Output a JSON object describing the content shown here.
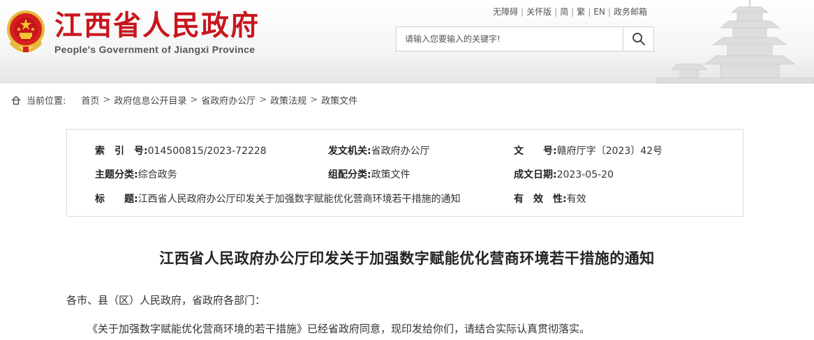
{
  "header": {
    "title_cn": "江西省人民政府",
    "title_en": "People's Government of Jiangxi Province",
    "links": [
      "无障碍",
      "关怀版",
      "简",
      "繁",
      "EN",
      "政务邮箱"
    ],
    "search_placeholder": "请输入您要输入的关键字!",
    "brand_color": "#c8161d"
  },
  "breadcrumb": {
    "label": "当前位置:",
    "items": [
      "首页",
      "政府信息公开目录",
      "省政府办公厅",
      "政策法规",
      "政策文件"
    ],
    "separator": ">"
  },
  "meta": {
    "index_no_label": "索　引　号:",
    "index_no": "014500815/2023-72228",
    "issuer_label": "发文机关:",
    "issuer": "省政府办公厅",
    "doc_no_label": "文　　号:",
    "doc_no": "赣府厅字〔2023〕42号",
    "topic_label": "主题分类:",
    "topic": "综合政务",
    "category_label": "组配分类:",
    "category": "政策文件",
    "date_label": "成文日期:",
    "date": "2023-05-20",
    "title_label": "标　　题:",
    "title": "江西省人民政府办公厅印发关于加强数字赋能优化营商环境若干措施的通知",
    "validity_label": "有　效　性:",
    "validity": "有效"
  },
  "doc": {
    "title": "江西省人民政府办公厅印发关于加强数字赋能优化营商环境若干措施的通知",
    "salutation": "各市、县（区）人民政府，省政府各部门：",
    "body": "《关于加强数字赋能优化营商环境的若干措施》已经省政府同意，现印发给你们，请结合实际认真贯彻落实。"
  }
}
